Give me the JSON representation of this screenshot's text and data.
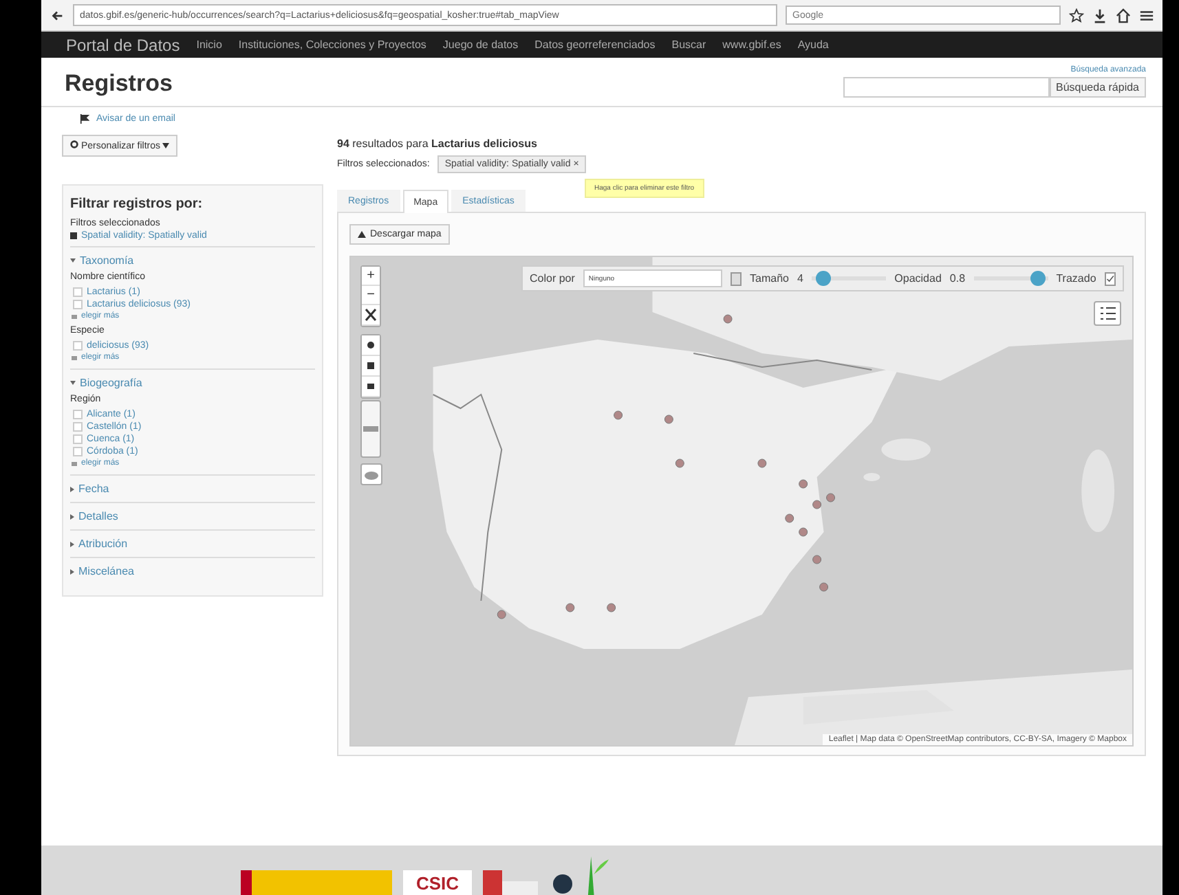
{
  "browser": {
    "url": "datos.gbif.es/generic-hub/occurrences/search?q=Lactarius+deliciosus&fq=geospatial_kosher:true#tab_mapView",
    "search_placeholder": "Google"
  },
  "nav": {
    "brand": "Portal de Datos",
    "items": [
      "Inicio",
      "Instituciones, Colecciones y Proyectos",
      "Juego de datos",
      "Datos georreferenciados",
      "Buscar",
      "www.gbif.es",
      "Ayuda"
    ]
  },
  "header": {
    "title": "Registros",
    "advanced_link": "Búsqueda avanzada",
    "search_button": "Búsqueda rápida",
    "alert_link": "Avisar de un email"
  },
  "sidebar": {
    "customize_button": "Personalizar filtros",
    "heading": "Filtrar registros por:",
    "selected_label": "Filtros seleccionados",
    "selected_filters": [
      "Spatial validity: Spatially valid"
    ],
    "sections": [
      {
        "title": "Taxonomía",
        "expanded": true,
        "groups": [
          {
            "label": "Nombre científico",
            "options": [
              {
                "label": "Lactarius (1)",
                "checked": false
              },
              {
                "label": "Lactarius deliciosus (93)",
                "checked": false
              }
            ],
            "more": "elegir más"
          },
          {
            "label": "Especie",
            "options": [
              {
                "label": "deliciosus (93)",
                "checked": false
              }
            ],
            "more": "elegir más"
          }
        ]
      },
      {
        "title": "Biogeografía",
        "expanded": true,
        "groups": [
          {
            "label": "Región",
            "options": [
              {
                "label": "Alicante (1)",
                "checked": false
              },
              {
                "label": "Castellón (1)",
                "checked": false
              },
              {
                "label": "Cuenca (1)",
                "checked": false
              },
              {
                "label": "Córdoba (1)",
                "checked": false
              }
            ],
            "more": "elegir más"
          }
        ]
      },
      {
        "title": "Fecha",
        "expanded": false
      },
      {
        "title": "Detalles",
        "expanded": false
      },
      {
        "title": "Atribución",
        "expanded": false
      },
      {
        "title": "Miscelánea",
        "expanded": false
      }
    ]
  },
  "results": {
    "summary": "**94** resultados para **Lactarius deliciosus**",
    "filters_label": "Filtros seleccionados:",
    "chips": [
      {
        "label": "Spatial validity: Spatially valid",
        "close": "×"
      }
    ],
    "tooltip": "Haga clic para eliminar este filtro"
  },
  "tabs": [
    {
      "label": "Registros",
      "selected": false
    },
    {
      "label": "Mapa",
      "selected": true
    },
    {
      "label": "Estadísticas",
      "selected": false
    }
  ],
  "map": {
    "download_button": "Descargar mapa",
    "zoom_in": "+",
    "zoom_out": "−",
    "zoom_slider": {
      "level": 0.5
    },
    "color_label": "Color por",
    "color_value": "Ninguno",
    "size_label": "Tamaño",
    "size_value": "4",
    "size_slider": {
      "level": 0.15
    },
    "opacity_label": "Opacidad",
    "opacity_value": "0.8",
    "opacity_slider": {
      "level": 0.85
    },
    "trace_label": "Trazado",
    "trace_checked": true,
    "attribution": "Leaflet | Map data © OpenStreetMap contributors, CC-BY-SA, Imagery © Mapbox"
  },
  "footer": {
    "logo_text": "CSIC"
  }
}
